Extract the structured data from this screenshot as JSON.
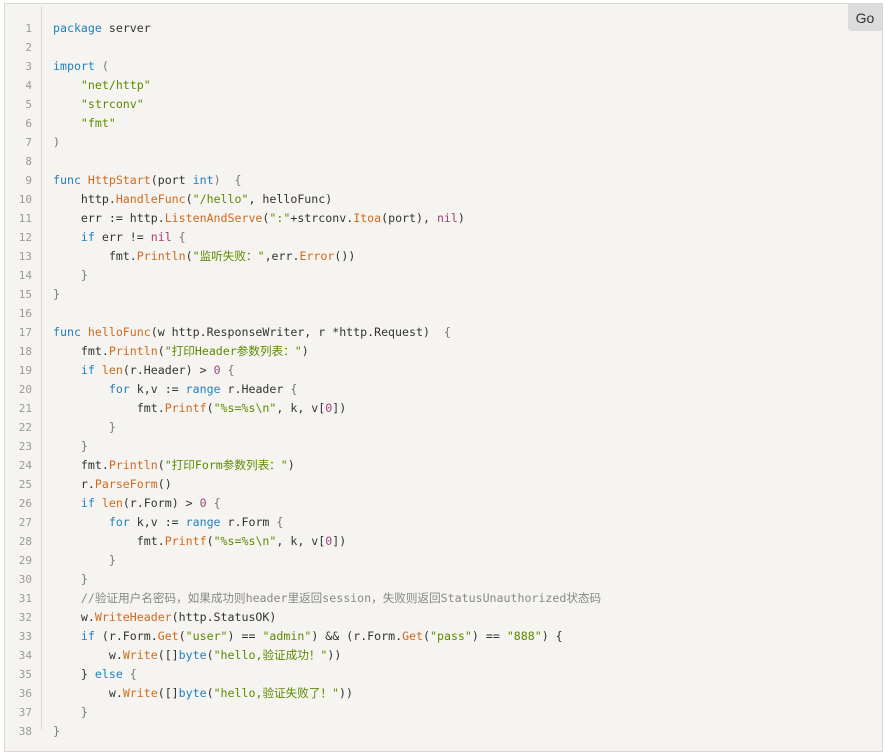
{
  "go_label": "Go",
  "lines": [
    [
      [
        "package",
        "kw"
      ],
      [
        " server",
        ""
      ]
    ],
    [],
    [
      [
        "import",
        "kw"
      ],
      [
        " (",
        "pu"
      ]
    ],
    [
      [
        "    ",
        ""
      ],
      [
        "\"net/http\"",
        "st"
      ]
    ],
    [
      [
        "    ",
        ""
      ],
      [
        "\"strconv\"",
        "st"
      ]
    ],
    [
      [
        "    ",
        ""
      ],
      [
        "\"fmt\"",
        "st"
      ]
    ],
    [
      [
        ")",
        "pu"
      ]
    ],
    [],
    [
      [
        "func",
        "kw"
      ],
      [
        " ",
        ""
      ],
      [
        "HttpStart",
        "fn"
      ],
      [
        "(port ",
        ""
      ],
      [
        "int",
        "kw"
      ],
      [
        ")  {",
        "pu"
      ]
    ],
    [
      [
        "    http.",
        ""
      ],
      [
        "HandleFunc",
        "fn"
      ],
      [
        "(",
        ""
      ],
      [
        "\"/hello\"",
        "st"
      ],
      [
        ", helloFunc)",
        ""
      ]
    ],
    [
      [
        "    err := http.",
        ""
      ],
      [
        "ListenAndServe",
        "fn"
      ],
      [
        "(",
        ""
      ],
      [
        "\":\"",
        "st"
      ],
      [
        "+strconv.",
        ""
      ],
      [
        "Itoa",
        "fn"
      ],
      [
        "(port), ",
        ""
      ],
      [
        "nil",
        "nl"
      ],
      [
        ")",
        ""
      ]
    ],
    [
      [
        "    ",
        ""
      ],
      [
        "if",
        "kw"
      ],
      [
        " err != ",
        ""
      ],
      [
        "nil",
        "nl"
      ],
      [
        " {",
        "pu"
      ]
    ],
    [
      [
        "        fmt.",
        ""
      ],
      [
        "Println",
        "fn"
      ],
      [
        "(",
        ""
      ],
      [
        "\"监听失败：\"",
        "st"
      ],
      [
        ",err.",
        ""
      ],
      [
        "Error",
        "fn"
      ],
      [
        "())",
        ""
      ]
    ],
    [
      [
        "    }",
        "pu"
      ]
    ],
    [
      [
        "}",
        "pu"
      ]
    ],
    [],
    [
      [
        "func",
        "kw"
      ],
      [
        " ",
        ""
      ],
      [
        "helloFunc",
        "fn"
      ],
      [
        "(w http.ResponseWriter, r *http.Request)  ",
        ""
      ],
      [
        "{",
        "pu"
      ]
    ],
    [
      [
        "    fmt.",
        ""
      ],
      [
        "Println",
        "fn"
      ],
      [
        "(",
        ""
      ],
      [
        "\"打印Header参数列表：\"",
        "st"
      ],
      [
        ")",
        ""
      ]
    ],
    [
      [
        "    ",
        ""
      ],
      [
        "if",
        "kw"
      ],
      [
        " ",
        ""
      ],
      [
        "len",
        "fn"
      ],
      [
        "(r.Header) > ",
        ""
      ],
      [
        "0",
        "nl"
      ],
      [
        " {",
        "pu"
      ]
    ],
    [
      [
        "        ",
        ""
      ],
      [
        "for",
        "kw"
      ],
      [
        " k,v := ",
        ""
      ],
      [
        "range",
        "kw"
      ],
      [
        " r.Header ",
        ""
      ],
      [
        "{",
        "pu"
      ]
    ],
    [
      [
        "            fmt.",
        ""
      ],
      [
        "Printf",
        "fn"
      ],
      [
        "(",
        ""
      ],
      [
        "\"%s=%s\\n\"",
        "st"
      ],
      [
        ", k, v[",
        ""
      ],
      [
        "0",
        "nl"
      ],
      [
        "])",
        ""
      ]
    ],
    [
      [
        "        }",
        "pu"
      ]
    ],
    [
      [
        "    }",
        "pu"
      ]
    ],
    [
      [
        "    fmt.",
        ""
      ],
      [
        "Println",
        "fn"
      ],
      [
        "(",
        ""
      ],
      [
        "\"打印Form参数列表：\"",
        "st"
      ],
      [
        ")",
        ""
      ]
    ],
    [
      [
        "    r.",
        ""
      ],
      [
        "ParseForm",
        "fn"
      ],
      [
        "()",
        ""
      ]
    ],
    [
      [
        "    ",
        ""
      ],
      [
        "if",
        "kw"
      ],
      [
        " ",
        ""
      ],
      [
        "len",
        "fn"
      ],
      [
        "(r.Form) > ",
        ""
      ],
      [
        "0",
        "nl"
      ],
      [
        " {",
        "pu"
      ]
    ],
    [
      [
        "        ",
        ""
      ],
      [
        "for",
        "kw"
      ],
      [
        " k,v := ",
        ""
      ],
      [
        "range",
        "kw"
      ],
      [
        " r.Form ",
        ""
      ],
      [
        "{",
        "pu"
      ]
    ],
    [
      [
        "            fmt.",
        ""
      ],
      [
        "Printf",
        "fn"
      ],
      [
        "(",
        ""
      ],
      [
        "\"%s=%s\\n\"",
        "st"
      ],
      [
        ", k, v[",
        ""
      ],
      [
        "0",
        "nl"
      ],
      [
        "])",
        ""
      ]
    ],
    [
      [
        "        }",
        "pu"
      ]
    ],
    [
      [
        "    }",
        "pu"
      ]
    ],
    [
      [
        "    ",
        ""
      ],
      [
        "//验证用户名密码，如果成功则header里返回session，失败则返回StatusUnauthorized状态码",
        "cm"
      ]
    ],
    [
      [
        "    w.",
        ""
      ],
      [
        "WriteHeader",
        "fn"
      ],
      [
        "(http.StatusOK)",
        ""
      ]
    ],
    [
      [
        "    ",
        ""
      ],
      [
        "if",
        "kw"
      ],
      [
        " (r.Form.",
        ""
      ],
      [
        "Get",
        "fn"
      ],
      [
        "(",
        ""
      ],
      [
        "\"user\"",
        "st"
      ],
      [
        ") == ",
        ""
      ],
      [
        "\"admin\"",
        "st"
      ],
      [
        ") && (r.Form.",
        ""
      ],
      [
        "Get",
        "fn"
      ],
      [
        "(",
        ""
      ],
      [
        "\"pass\"",
        "st"
      ],
      [
        ") == ",
        ""
      ],
      [
        "\"888\"",
        "st"
      ],
      [
        ") {",
        ""
      ]
    ],
    [
      [
        "        w.",
        ""
      ],
      [
        "Write",
        "fn"
      ],
      [
        "([]",
        ""
      ],
      [
        "byte",
        "kw"
      ],
      [
        "(",
        ""
      ],
      [
        "\"hello,验证成功！\"",
        "st"
      ],
      [
        "))",
        ""
      ]
    ],
    [
      [
        "    } ",
        ""
      ],
      [
        "else",
        "kw"
      ],
      [
        " {",
        "pu"
      ]
    ],
    [
      [
        "        w.",
        ""
      ],
      [
        "Write",
        "fn"
      ],
      [
        "([]",
        ""
      ],
      [
        "byte",
        "kw"
      ],
      [
        "(",
        ""
      ],
      [
        "\"hello,验证失败了！\"",
        "st"
      ],
      [
        "))",
        ""
      ]
    ],
    [
      [
        "    }",
        "pu"
      ]
    ],
    [
      [
        "}",
        "pu"
      ]
    ]
  ]
}
